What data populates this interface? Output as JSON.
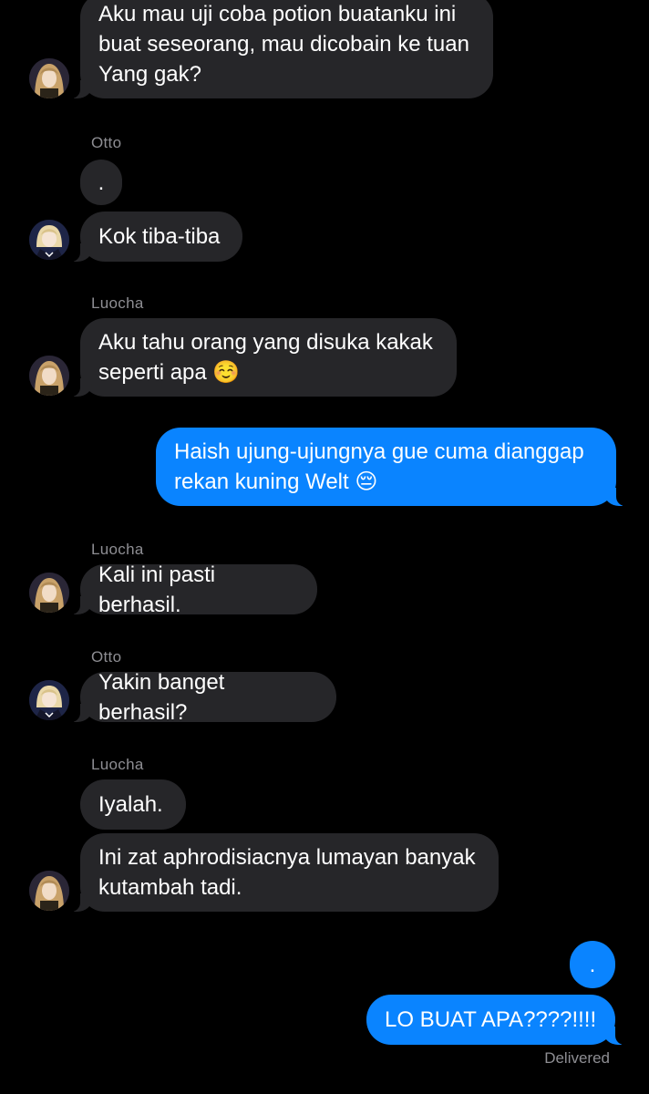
{
  "contacts": {
    "luocha": {
      "name": "Luocha",
      "avatar_icon": "luocha-avatar-icon",
      "hair_color": "#c9a26a"
    },
    "otto": {
      "name": "Otto",
      "avatar_icon": "otto-avatar-icon",
      "hair_color": "#e9d7a8"
    }
  },
  "messages": [
    {
      "from": "Luocha",
      "text": "Aku mau uji coba potion buatanku ini\nbuat seseorang, mau dicobain ke tuan\nYang gak?"
    },
    {
      "sender_label": "Otto",
      "from": "Otto",
      "text": "."
    },
    {
      "from": "Otto",
      "text": "Kok tiba-tiba"
    },
    {
      "sender_label": "Luocha",
      "from": "Luocha",
      "text": "Aku tahu orang yang disuka kakak\nseperti apa ",
      "emoji": "☺️"
    },
    {
      "from": "me",
      "text": "Haish ujung-ujungnya gue cuma dianggap\nrekan kuning Welt ",
      "emoji": "😔"
    },
    {
      "sender_label": "Luocha",
      "from": "Luocha",
      "text": "Kali ini pasti berhasil."
    },
    {
      "sender_label": "Otto",
      "from": "Otto",
      "text": "Yakin banget berhasil?"
    },
    {
      "sender_label": "Luocha",
      "from": "Luocha",
      "text": "Iyalah."
    },
    {
      "from": "Luocha",
      "text": "Ini zat aphrodisiacnya lumayan banyak\nkutambah tadi."
    },
    {
      "from": "me",
      "text": "."
    },
    {
      "from": "me",
      "text": "LO BUAT APA????!!!!"
    }
  ],
  "status": {
    "delivered_label": "Delivered"
  },
  "colors": {
    "background": "#000000",
    "incoming_bubble": "#262629",
    "outgoing_bubble": "#0a84ff",
    "sender_label": "#8e8e93"
  }
}
